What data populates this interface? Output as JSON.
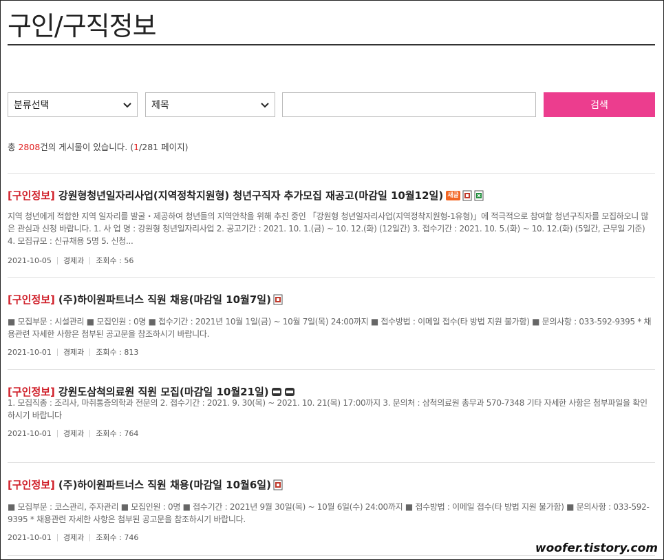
{
  "page": {
    "title": "구인/구직정보"
  },
  "search": {
    "category_select": "분류선택",
    "field_select": "제목",
    "keyword_value": "",
    "submit_label": "검색"
  },
  "summary": {
    "prefix": "총 ",
    "total": "2808",
    "middle": "건의 게시물이 있습니다. (",
    "current_page": "1",
    "pages": "/281 페이지)"
  },
  "posts": [
    {
      "category": "[구인정보]",
      "title": "강원형청년일자리사업(지역정착지원형) 청년구직자 추가모집 재공고(마감일 10월12일)",
      "new_badge": "새글",
      "summary": "지역 청년에게 적합한 지역 일자리를 발굴・제공하여 청년들의 지역안착을 위해 추진 중인 「강원형 청년일자리사업(지역정착지원형-1유형)」에 적극적으로 참여할 청년구직자를 모집하오니 많은 관심과 신청 바랍니다. 1. 사 업 명 : 강원형 청년일자리사업 2. 공고기간 : 2021. 10. 1.(금) ~ 10. 12.(화) (12일간) 3. 접수기간 : 2021. 10. 5.(화) ~ 10. 12.(화) (5일간, 근무일 기준) 4. 모집규모 : 신규채용 5명 5. 신청...",
      "date": "2021-10-05",
      "dept": "경제과",
      "views": "조회수 : 56"
    },
    {
      "category": "[구인정보]",
      "title": "(주)하이원파트너스 직원 채용(마감일 10월7일)",
      "summary": "■ 모집부문 : 시설관리 ■ 모집인원 : 0명 ■ 접수기간 : 2021년 10월 1일(금) ~ 10월 7일(목) 24:00까지 ■ 접수방법 : 이메일 접수(타 방법 지원 불가함) ■ 문의사항 : 033-592-9395 * 채용관련 자세한 사항은 첨부된 공고문을 참조하시기 바랍니다.",
      "date": "2021-10-01",
      "dept": "경제과",
      "views": "조회수 : 813"
    },
    {
      "category": "[구인정보]",
      "title": "강원도삼척의료원 직원 모집(마감일 10월21일)",
      "summary": "1. 모집직종 : 조리사, 마취통증의학과 전문의 2. 접수기간 : 2021. 9. 30(목) ~ 2021. 10. 21(목) 17:00까지 3. 문의처 : 삼척의료원 총무과 570-7348 기타 자세한 사항은 첨부파일을 확인하시기 바랍니다",
      "date": "2021-10-01",
      "dept": "경제과",
      "views": "조회수 : 764"
    },
    {
      "category": "[구인정보]",
      "title": "(주)하이원파트너스 직원 채용(마감일 10월6일)",
      "summary": "■ 모집부문 : 코스관리, 주자관리 ■ 모집인원 : 0명 ■ 접수기간 : 2021년 9월 30일(목) ~ 10월 6일(수) 24:00까지 ■ 접수방법 : 이메일 접수(타 방법 지원 불가함) ■ 문의사항 : 033-592-9395 * 채용관련 자세한 사항은 첨부된 공고문을 참조하시기 바랍니다.",
      "date": "2021-10-01",
      "dept": "경제과",
      "views": "조회수 : 746"
    }
  ],
  "watermark": "woofer.tistory.com"
}
